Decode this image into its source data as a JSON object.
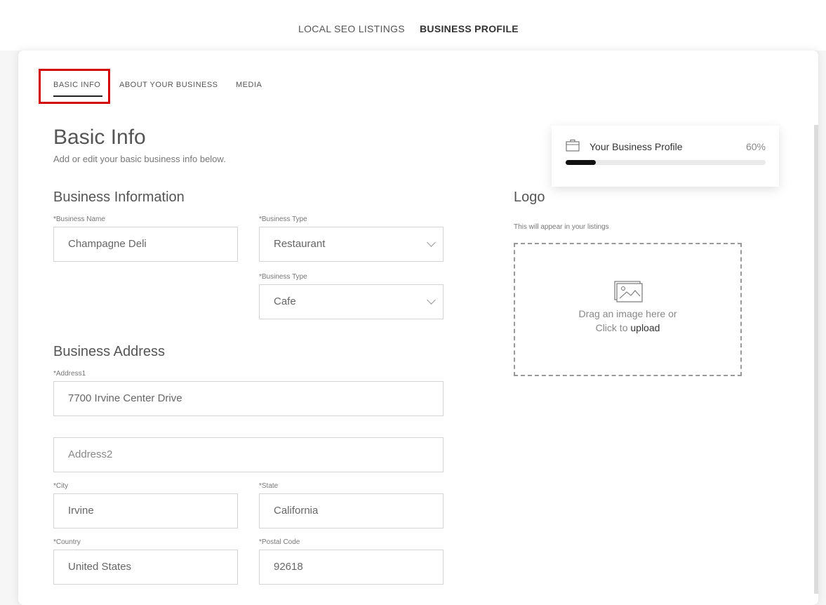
{
  "topnav": {
    "link1": "LOCAL SEO LISTINGS",
    "link2": "BUSINESS PROFILE"
  },
  "subtabs": {
    "basic": "BASIC INFO",
    "about": "ABOUT YOUR BUSINESS",
    "media": "MEDIA"
  },
  "page": {
    "title": "Basic Info",
    "subtitle": "Add or edit your basic business info below."
  },
  "business_info": {
    "title": "Business Information",
    "name_label": "*Business Name",
    "name_value": "Champagne Deli",
    "type1_label": "*Business Type",
    "type1_value": "Restaurant",
    "type2_label": "*Business Type",
    "type2_value": "Cafe"
  },
  "address": {
    "title": "Business Address",
    "addr1_label": "*Address1",
    "addr1_value": "7700 Irvine Center Drive",
    "addr2_placeholder": "Address2",
    "city_label": "*City",
    "city_value": "Irvine",
    "state_label": "*State",
    "state_value": "California",
    "country_label": "*Country",
    "country_value": "United States",
    "postal_label": "*Postal Code",
    "postal_value": "92618"
  },
  "profile_progress": {
    "title": "Your Business Profile",
    "percent_text": "60%",
    "fraction": 0.15
  },
  "logo": {
    "title": "Logo",
    "subtitle": "This will appear in your listings",
    "drag_text": "Drag an image here or",
    "click_text": "Click to",
    "upload_link": "upload"
  },
  "colors": {
    "highlight": "#d40000",
    "progress_fill": "#111111"
  },
  "icons": {
    "profile": "briefcase-icon",
    "image": "image-icon",
    "dropdown": "chevron-down-icon"
  }
}
